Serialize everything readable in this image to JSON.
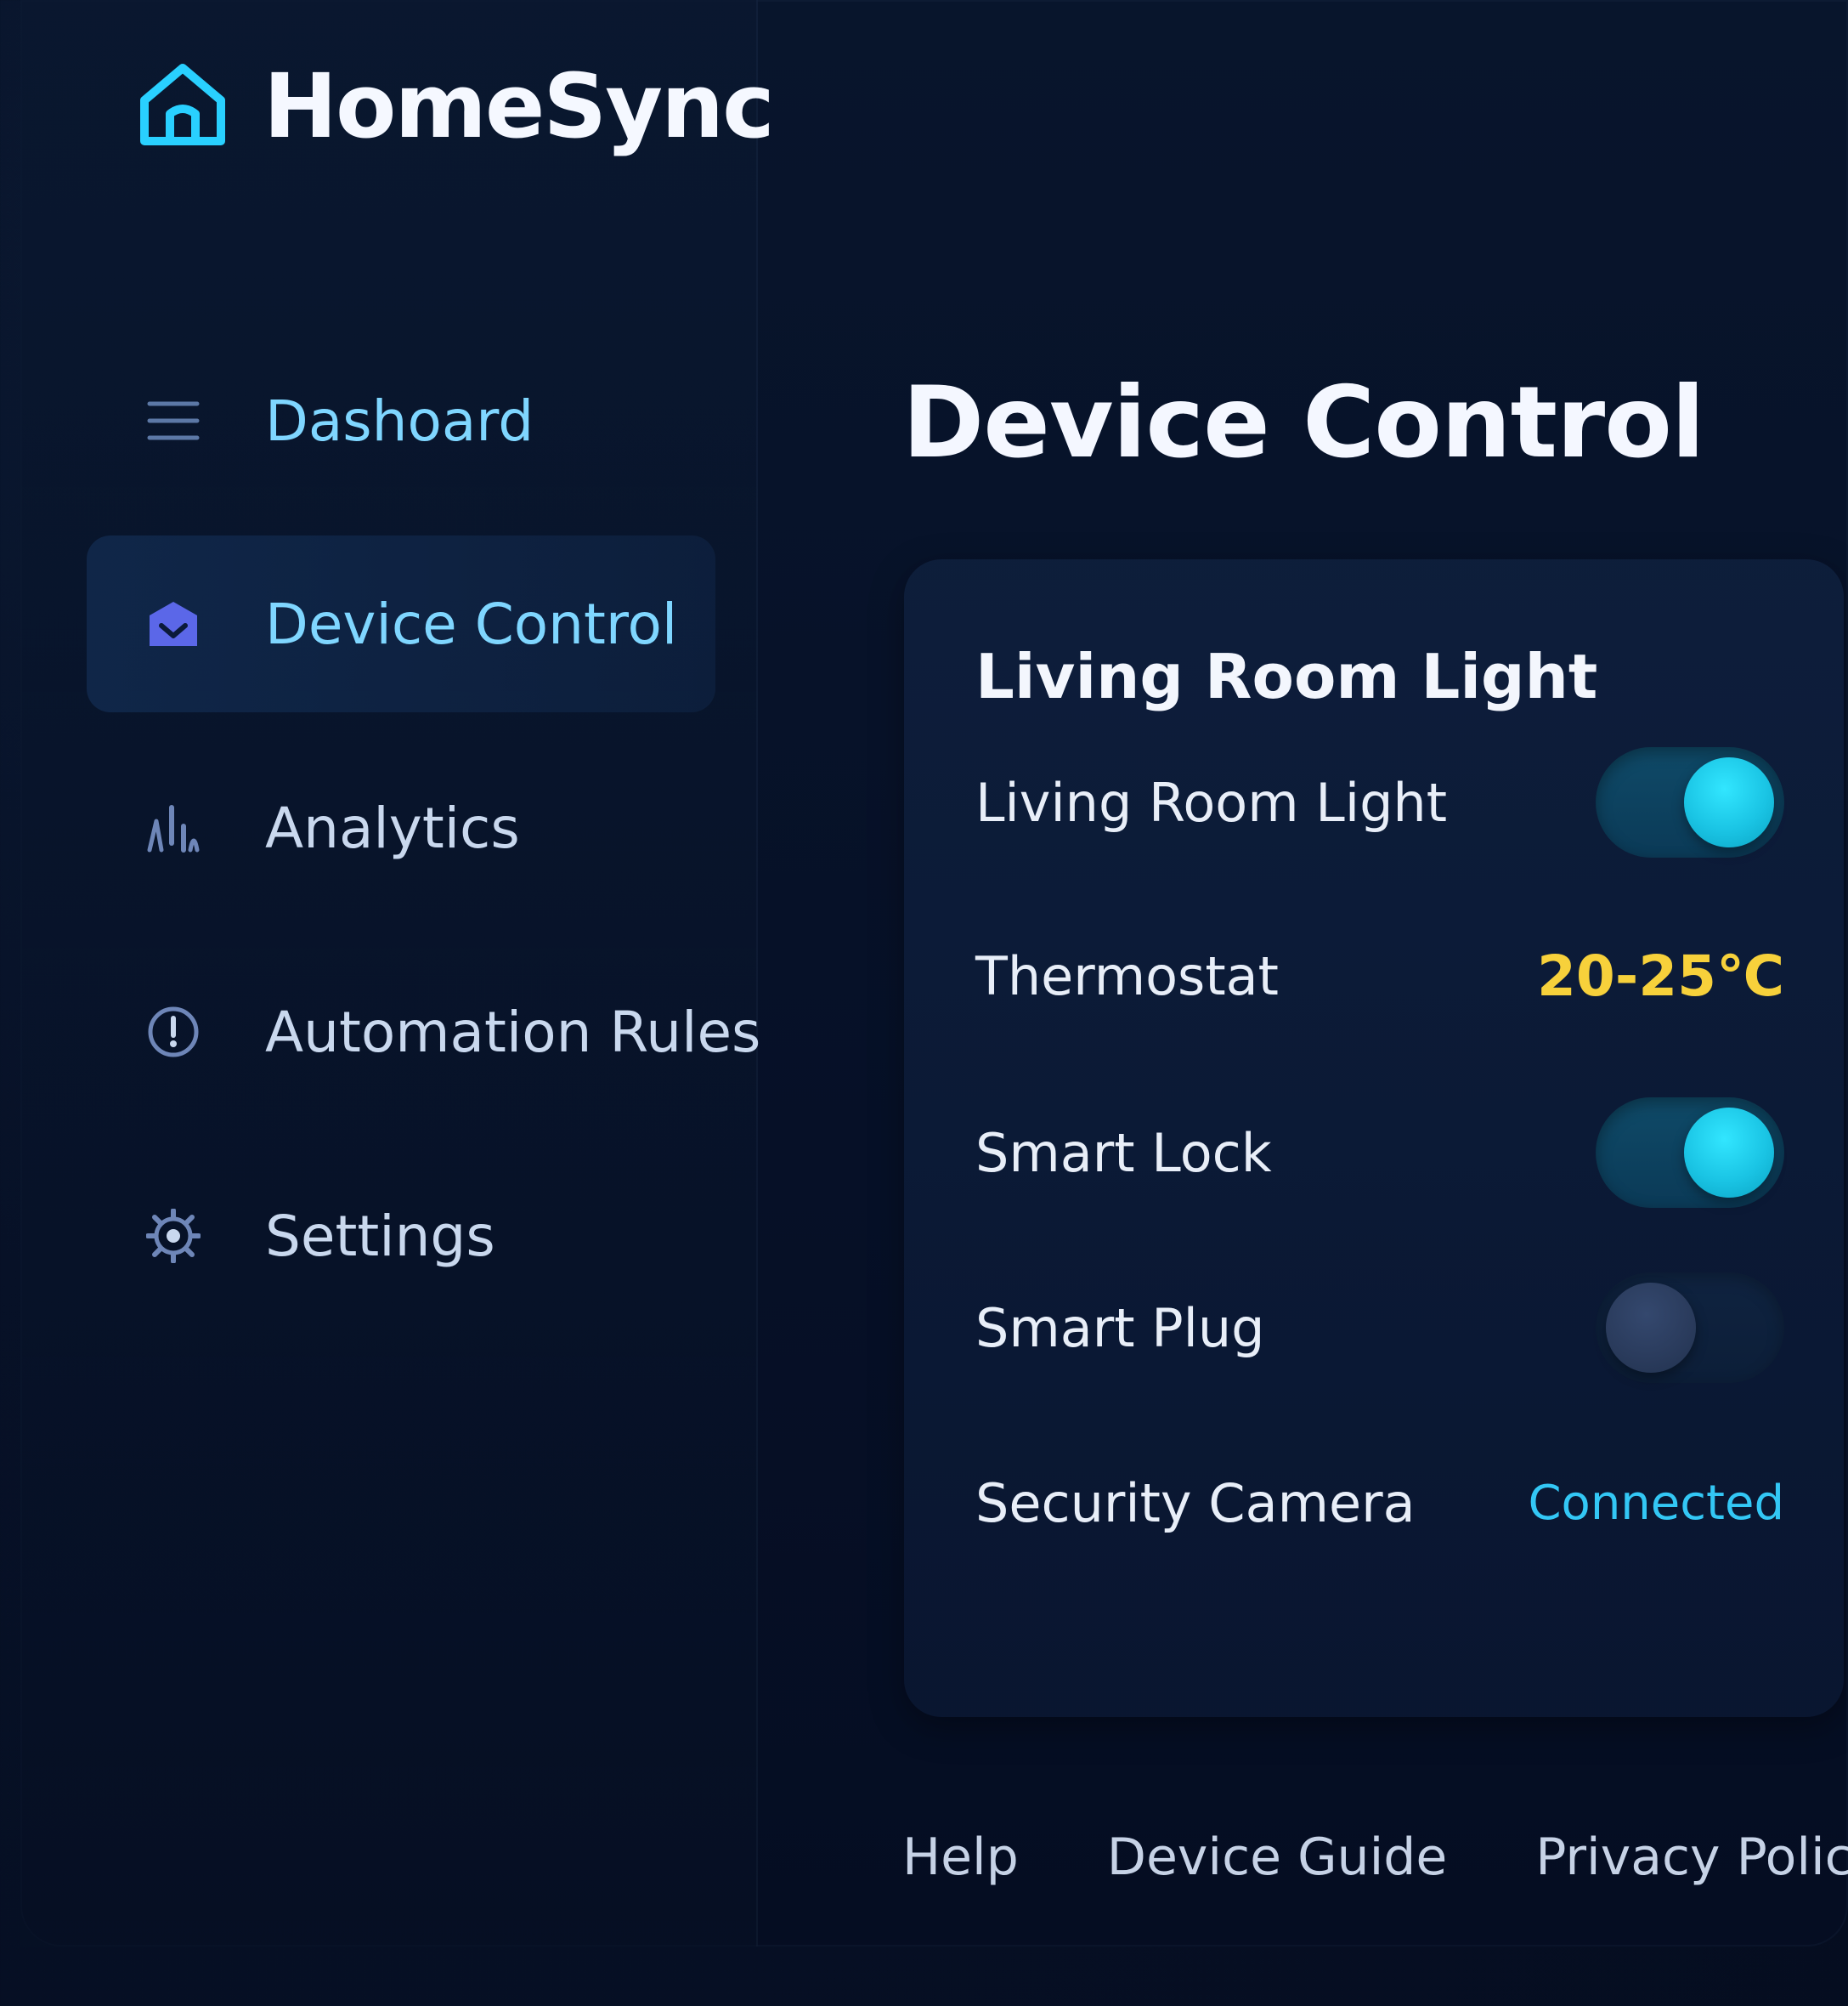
{
  "brand": {
    "name": "HomeSync",
    "icon": "home-icon",
    "accent": "#29d0ff"
  },
  "sidebar": {
    "items": [
      {
        "label": "Dashoard",
        "icon": "menu-icon"
      },
      {
        "label": "Device Control",
        "icon": "home-chevron-icon",
        "active": true
      },
      {
        "label": "Analytics",
        "icon": "analytics-icon"
      },
      {
        "label": "Automation Rules",
        "icon": "alert-icon"
      },
      {
        "label": "Settings",
        "icon": "gear-icon"
      }
    ]
  },
  "main": {
    "title": "Device Control",
    "card": {
      "title": "Living Room Light",
      "devices": [
        {
          "label": "Living Room Light",
          "type": "toggle",
          "on": true
        },
        {
          "label": "Thermostat",
          "type": "value",
          "value": "20-25℃",
          "color": "#f7d13b"
        },
        {
          "label": "Smart Lock",
          "type": "toggle",
          "on": true
        },
        {
          "label": "Smart Plug",
          "type": "toggle",
          "on": false
        },
        {
          "label": "Security Camera",
          "type": "status",
          "value": "Connected",
          "color": "#33c7f5"
        }
      ]
    }
  },
  "footer": {
    "links": [
      "Help",
      "Device Guide",
      "Privacy Policy"
    ]
  },
  "colors": {
    "background": "#061027",
    "toggle_on_knob": "#1ac4e4",
    "toggle_off_knob": "#2a3b5c"
  }
}
